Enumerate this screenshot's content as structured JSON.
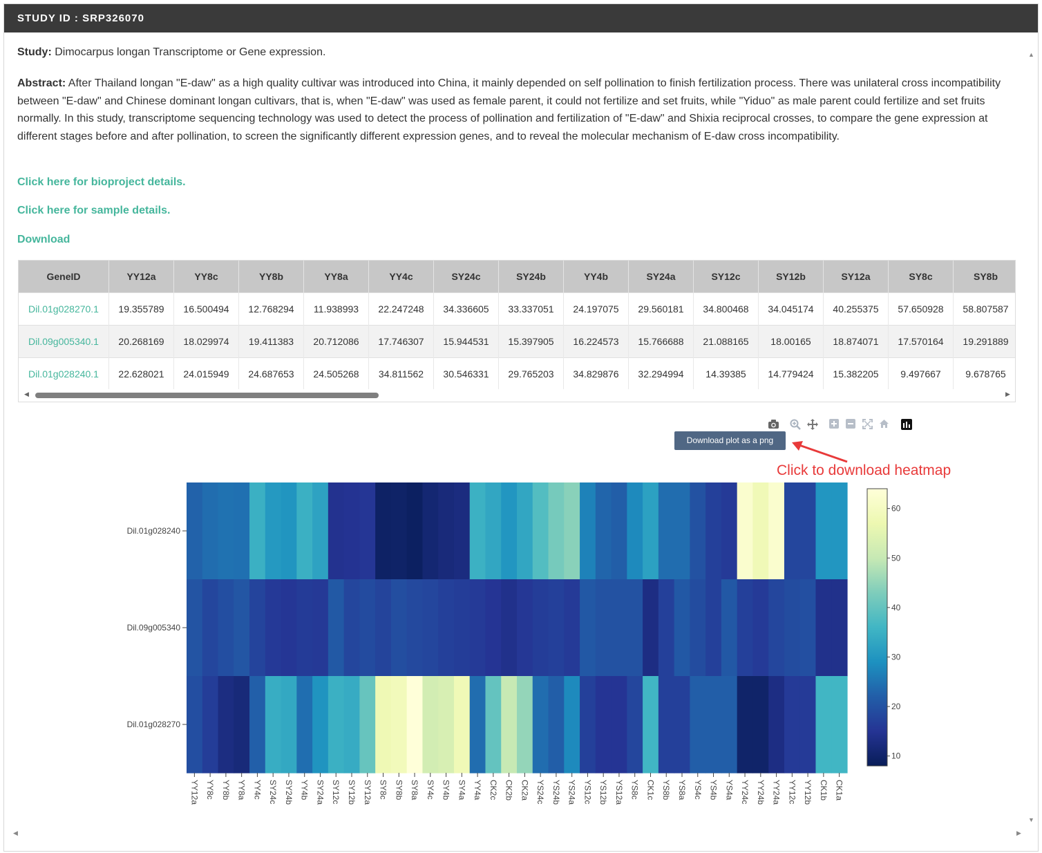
{
  "header": {
    "title": "STUDY ID : SRP326070"
  },
  "study": {
    "label": "Study:",
    "text": "Dimocarpus longan Transcriptome or Gene expression."
  },
  "abstract": {
    "label": "Abstract:",
    "text": "After Thailand longan \"E-daw\" as a high quality cultivar was introduced into China, it mainly depended on self pollination to finish fertilization process. There was unilateral cross incompatibility between \"E-daw\" and Chinese dominant longan cultivars, that is, when \"E-daw\" was used as female parent, it could not fertilize and set fruits, while \"Yiduo\" as male parent could fertilize and set fruits normally. In this study, transcriptome sequencing technology was used to detect the process of pollination and fertilization of \"E-daw\" and Shixia reciprocal crosses, to compare the gene expression at different stages before and after pollination, to screen the significantly different expression genes, and to reveal the molecular mechanism of E-daw cross incompatibility."
  },
  "links": {
    "bioproject": "Click here for bioproject details.",
    "sample": "Click here for sample details.",
    "download": "Download"
  },
  "table": {
    "headers": [
      "GeneID",
      "YY12a",
      "YY8c",
      "YY8b",
      "YY8a",
      "YY4c",
      "SY24c",
      "SY24b",
      "YY4b",
      "SY24a",
      "SY12c",
      "SY12b",
      "SY12a",
      "SY8c",
      "SY8b"
    ],
    "rows": [
      [
        "Dil.01g028270.1",
        "19.355789",
        "16.500494",
        "12.768294",
        "11.938993",
        "22.247248",
        "34.336605",
        "33.337051",
        "24.197075",
        "29.560181",
        "34.800468",
        "34.045174",
        "40.255375",
        "57.650928",
        "58.807587"
      ],
      [
        "Dil.09g005340.1",
        "20.268169",
        "18.029974",
        "19.411383",
        "20.712086",
        "17.746307",
        "15.944531",
        "15.397905",
        "16.224573",
        "15.766688",
        "21.088165",
        "18.00165",
        "18.874071",
        "17.570164",
        "19.291889"
      ],
      [
        "Dil.01g028240.1",
        "22.628021",
        "24.015949",
        "24.687653",
        "24.505268",
        "34.811562",
        "30.546331",
        "29.765203",
        "34.829876",
        "32.294994",
        "14.39385",
        "14.779424",
        "15.382205",
        "9.497667",
        "9.678765"
      ]
    ]
  },
  "toolbar": {
    "icons": [
      "camera-icon",
      "zoom-icon",
      "pan-icon",
      "zoom-in-icon",
      "zoom-out-icon",
      "autoscale-icon",
      "reset-axes-icon",
      "plotly-logo-icon"
    ],
    "tooltip": "Download plot as a png"
  },
  "annotation": {
    "text": "Click to download heatmap",
    "color": "#e83a3a"
  },
  "chart_data": {
    "type": "heatmap",
    "title": "",
    "x": [
      "YY12a",
      "YY8c",
      "YY8b",
      "YY8a",
      "YY4c",
      "SY24c",
      "SY24b",
      "YY4b",
      "SY24a",
      "SY12c",
      "SY12b",
      "SY12a",
      "SY8c",
      "SY8b",
      "SY8a",
      "SY4c",
      "SY4b",
      "SY4a",
      "YY4a",
      "CK2c",
      "CK2b",
      "CK2a",
      "YS24c",
      "YS24b",
      "YS24a",
      "YS12c",
      "YS12b",
      "YS12a",
      "YS8c",
      "CK1c",
      "YS8b",
      "YS8a",
      "YS4c",
      "YS4b",
      "YS4a",
      "YY24c",
      "YY24b",
      "YY24a",
      "YY12c",
      "YY12b",
      "CK1b",
      "CK1a"
    ],
    "y": [
      "Dil.01g028240",
      "Dil.09g005340",
      "Dil.01g028270"
    ],
    "z": [
      [
        22.6,
        24.0,
        24.7,
        24.5,
        34.8,
        30.5,
        29.8,
        34.8,
        32.3,
        14.4,
        14.8,
        15.4,
        9.5,
        9.7,
        9.0,
        11.0,
        12.0,
        12.5,
        35.0,
        33.0,
        30.0,
        33.0,
        38.0,
        42.0,
        44.0,
        27.0,
        23.0,
        22.0,
        28.0,
        32.0,
        24.0,
        24.0,
        20.0,
        17.0,
        16.0,
        62.0,
        58.0,
        62.0,
        18.0,
        18.0,
        30.0,
        30.0
      ],
      [
        20.3,
        18.0,
        19.4,
        20.7,
        17.7,
        15.9,
        15.4,
        16.2,
        15.8,
        21.1,
        18.0,
        18.9,
        17.6,
        19.3,
        18.5,
        18.0,
        17.0,
        16.5,
        16.0,
        15.0,
        14.0,
        15.5,
        16.5,
        17.0,
        16.0,
        21.0,
        20.0,
        20.0,
        20.0,
        13.0,
        17.0,
        21.0,
        19.0,
        17.0,
        21.0,
        17.0,
        16.0,
        18.0,
        19.0,
        19.5,
        14.0,
        14.0
      ],
      [
        19.4,
        16.5,
        12.8,
        11.9,
        22.2,
        34.3,
        33.3,
        24.2,
        29.6,
        34.8,
        34.0,
        40.3,
        57.7,
        58.8,
        64.0,
        52.0,
        53.0,
        58.0,
        24.0,
        40.0,
        50.0,
        45.0,
        24.0,
        22.0,
        28.0,
        17.0,
        15.0,
        15.0,
        18.0,
        36.0,
        17.0,
        17.0,
        22.0,
        22.0,
        22.0,
        10.0,
        10.0,
        13.0,
        16.0,
        16.0,
        36.0,
        36.0
      ]
    ],
    "colorscale": "YlGnBu",
    "zmin": 8,
    "zmax": 64,
    "colorbar_ticks": [
      10,
      20,
      30,
      40,
      50,
      60
    ],
    "xlabel": "",
    "ylabel": ""
  }
}
